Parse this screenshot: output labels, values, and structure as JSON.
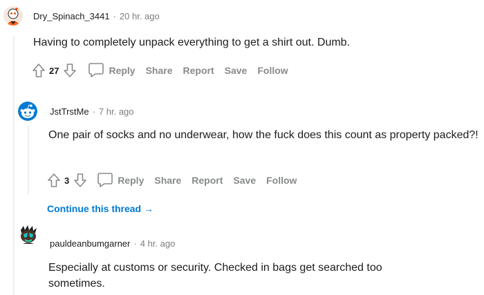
{
  "comments": [
    {
      "author": "Dry_Spinach_3441",
      "time": "20 hr. ago",
      "text": "Having to completely unpack everything to get a shirt out. Dumb.",
      "score": "27",
      "avatar_icon": "snoo-avatar-orange"
    },
    {
      "author": "JstTrstMe",
      "time": "7 hr. ago",
      "text": "One pair of socks and no underwear, how the fuck does this count as property packed?!",
      "score": "3",
      "avatar_icon": "snoo-avatar-blue"
    },
    {
      "author": "pauldeanbumgarner",
      "time": "4 hr. ago",
      "text": "Especially at customs or security. Checked in bags get searched too sometimes.",
      "avatar_icon": "snoo-avatar-teal"
    }
  ],
  "actions": {
    "reply": "Reply",
    "share": "Share",
    "report": "Report",
    "save": "Save",
    "follow": "Follow"
  },
  "separator": "·",
  "continue_thread": "Continue this thread",
  "continue_arrow": "→",
  "colors": {
    "text": "#1c1c1c",
    "meta": "#7c7c7c",
    "action": "#878a8c",
    "link": "#0079d3",
    "thread_line": "#edeff1"
  }
}
